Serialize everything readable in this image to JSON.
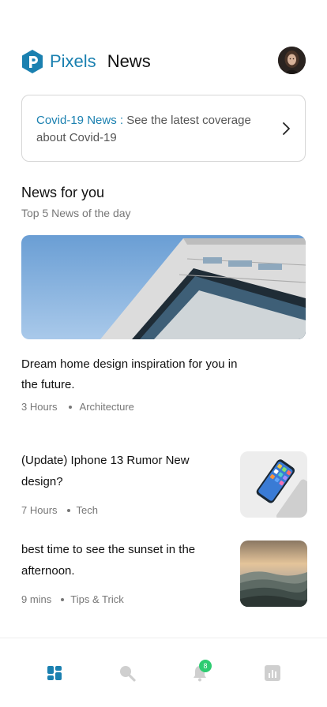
{
  "header": {
    "brand_part1": "Pixels",
    "brand_part2": "News",
    "logo_icon": "p-logo-icon",
    "avatar_icon": "user-avatar"
  },
  "banner": {
    "highlight": "Covid-19 News :",
    "text": " See the latest coverage about Covid-19",
    "chevron_icon": "chevron-right-icon"
  },
  "section": {
    "title": "News for you",
    "subtitle": "Top 5 News of the day"
  },
  "featured": {
    "headline": "Dream home design inspiration for you in the future.",
    "time": "3 Hours",
    "category": "Architecture"
  },
  "articles": [
    {
      "title": "(Update) Iphone 13 Rumor New design?",
      "time": "7 Hours",
      "category": "Tech"
    },
    {
      "title": "best time to see the sunset in the afternoon.",
      "time": "9 mins",
      "category": "Tips & Trick"
    }
  ],
  "tabbar": {
    "items": [
      {
        "icon": "dashboard-icon",
        "active": true
      },
      {
        "icon": "search-icon",
        "active": false
      },
      {
        "icon": "bell-icon",
        "active": false,
        "badge": "8"
      },
      {
        "icon": "chart-icon",
        "active": false
      }
    ]
  },
  "colors": {
    "accent": "#1a80b0",
    "badge": "#2ecc71",
    "inactive_icon": "#cfcfcf"
  }
}
